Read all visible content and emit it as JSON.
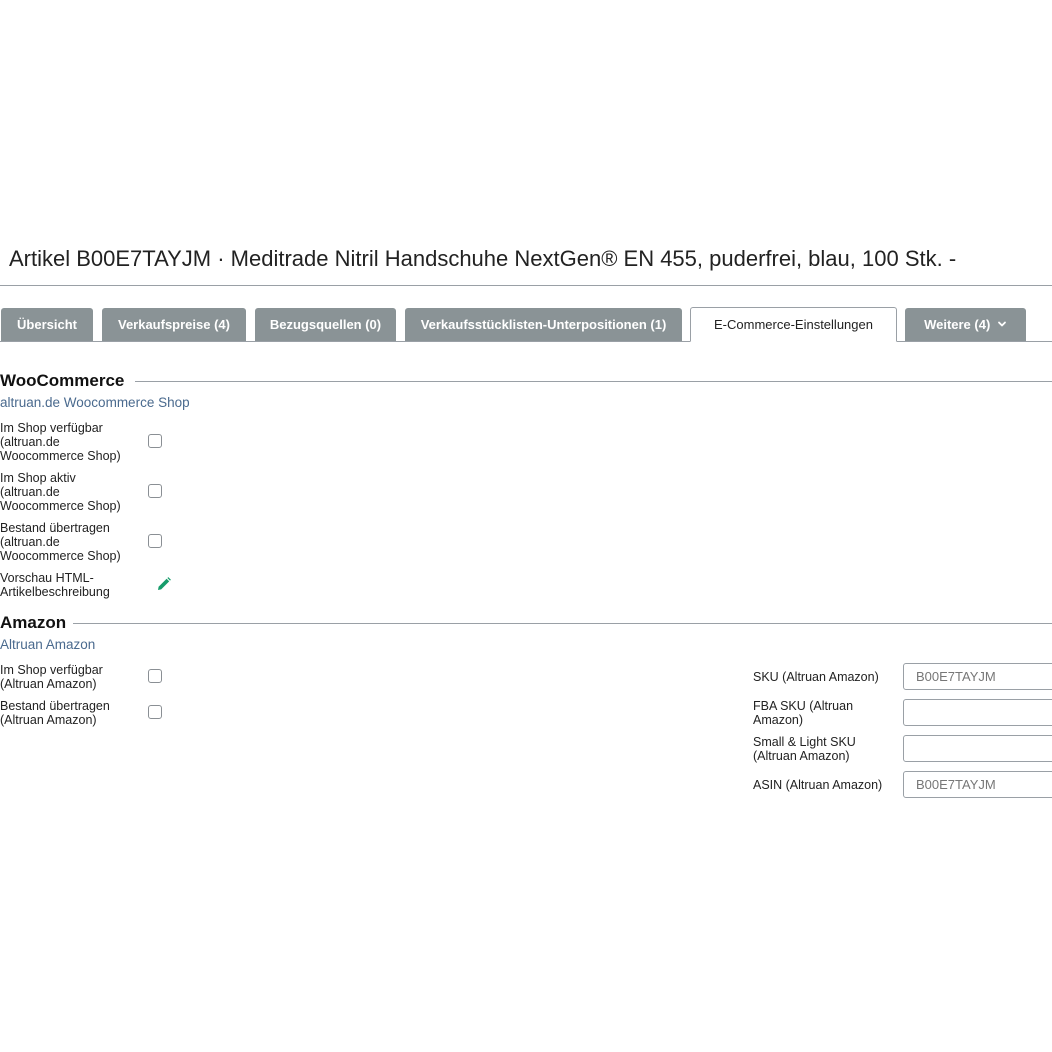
{
  "title": "Artikel B00E7TAYJM · Meditrade Nitril Handschuhe NextGen® EN 455, puderfrei, blau, 100 Stk. -",
  "tabs": [
    {
      "label": "Übersicht"
    },
    {
      "label": "Verkaufspreise (4)"
    },
    {
      "label": "Bezugsquellen (0)"
    },
    {
      "label": "Verkaufsstücklisten-Unterpositionen (1)"
    },
    {
      "label": "E-Commerce-Einstellungen",
      "active": true
    },
    {
      "label": "Weitere (4)",
      "icon": "chevron-down-icon"
    }
  ],
  "woocommerce": {
    "heading": "WooCommerce",
    "shop": "altruan.de Woocommerce Shop",
    "fields": [
      {
        "label": "Im Shop verfügbar (altruan.de Woocommerce Shop)",
        "checked": false
      },
      {
        "label": "Im Shop aktiv (altruan.de Woocommerce Shop)",
        "checked": false
      },
      {
        "label": "Bestand übertragen (altruan.de Woocommerce Shop)",
        "checked": false
      }
    ],
    "preview_label": "Vorschau HTML-Artikelbeschreibung",
    "preview_icon": "pencil-icon",
    "accent": "#169c6b"
  },
  "amazon": {
    "heading": "Amazon",
    "shop": "Altruan Amazon",
    "fields": [
      {
        "label": "Im Shop verfügbar (Altruan Amazon)",
        "checked": false
      },
      {
        "label": "Bestand übertragen (Altruan Amazon)",
        "checked": false
      }
    ],
    "inputs": [
      {
        "label": "SKU (Altruan Amazon)",
        "value": "",
        "placeholder": "B00E7TAYJM"
      },
      {
        "label": "FBA SKU (Altruan Amazon)",
        "value": "",
        "placeholder": ""
      },
      {
        "label": "Small & Light SKU (Altruan Amazon)",
        "value": "",
        "placeholder": ""
      },
      {
        "label": "ASIN (Altruan Amazon)",
        "value": "",
        "placeholder": "B00E7TAYJM"
      }
    ]
  }
}
